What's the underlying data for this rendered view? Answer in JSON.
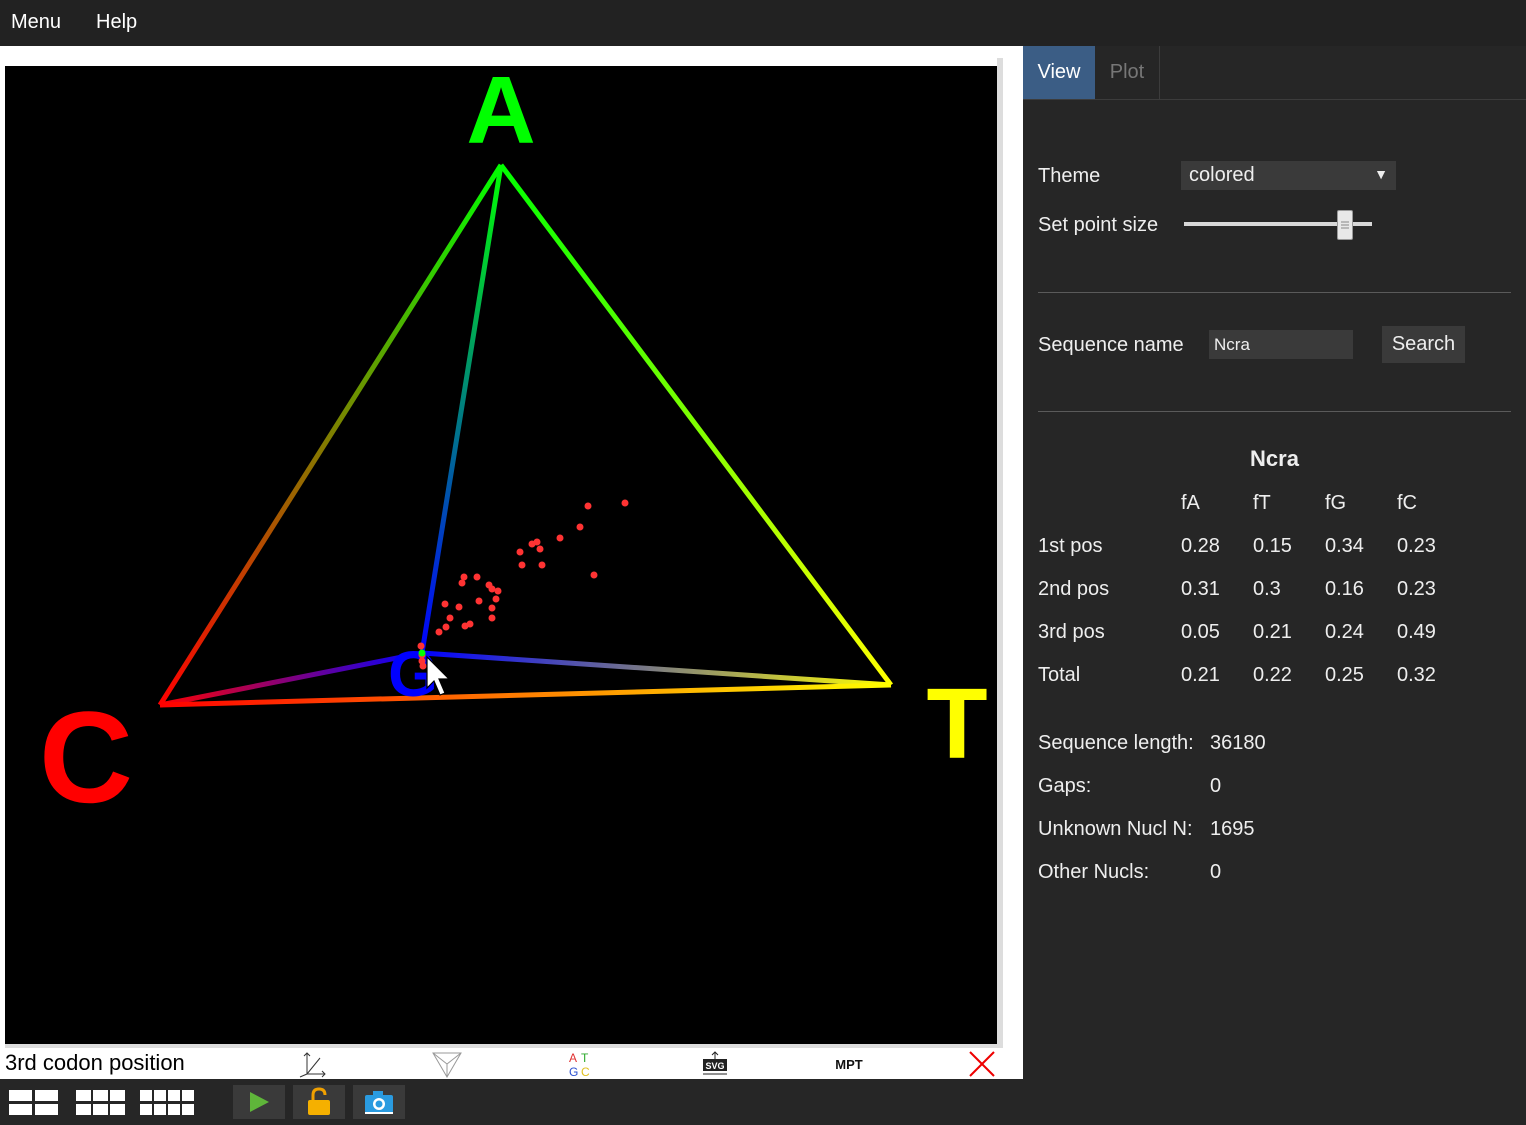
{
  "menu": {
    "items": [
      "Menu",
      "Help"
    ]
  },
  "plot": {
    "vertex_labels": {
      "a": "A",
      "c": "C",
      "t": "T",
      "g": "G"
    },
    "colors": {
      "a": "#00ff00",
      "c": "#ff0000",
      "t": "#ffff00",
      "g": "#0000ff",
      "points": "#ff3333",
      "background": "#000000"
    },
    "caption": "3rd codon position"
  },
  "plot_toolbar": {
    "icons": [
      "axes-icon",
      "tetrahedron-view-icon",
      "atgc-labels-icon",
      "svg-export-icon",
      "mpt-icon",
      "close-icon"
    ],
    "svg_label": "SVG",
    "mpt_label": "MPT",
    "atgc_letters": [
      "A",
      "T",
      "G",
      "C"
    ]
  },
  "bottom_toolbar": {
    "icons": [
      "layout-2x2-icon",
      "layout-3x2-icon",
      "layout-4x2-icon",
      "play-icon",
      "lock-icon",
      "camera-icon"
    ]
  },
  "panel": {
    "tabs": [
      {
        "label": "View",
        "active": true
      },
      {
        "label": "Plot",
        "active": false
      }
    ],
    "theme": {
      "label": "Theme",
      "value": "colored"
    },
    "point_size": {
      "label": "Set point size",
      "fraction": 0.85
    },
    "sequence_search": {
      "label": "Sequence name",
      "value": "Ncra",
      "button": "Search"
    },
    "composition": {
      "title": "Ncra",
      "columns": [
        "fA",
        "fT",
        "fG",
        "fC"
      ],
      "rows": [
        {
          "label": "1st pos",
          "values": [
            "0.28",
            "0.15",
            "0.34",
            "0.23"
          ]
        },
        {
          "label": "2nd pos",
          "values": [
            "0.31",
            "0.3",
            "0.16",
            "0.23"
          ]
        },
        {
          "label": "3rd pos",
          "values": [
            "0.05",
            "0.21",
            "0.24",
            "0.49"
          ]
        },
        {
          "label": "Total",
          "values": [
            "0.21",
            "0.22",
            "0.25",
            "0.32"
          ]
        }
      ]
    },
    "stats": [
      {
        "label": "Sequence length:",
        "value": "36180"
      },
      {
        "label": "Gaps:",
        "value": "0"
      },
      {
        "label": "Unknown Nucl N:",
        "value": "1695"
      },
      {
        "label": "Other Nucls:",
        "value": "0"
      }
    ]
  }
}
